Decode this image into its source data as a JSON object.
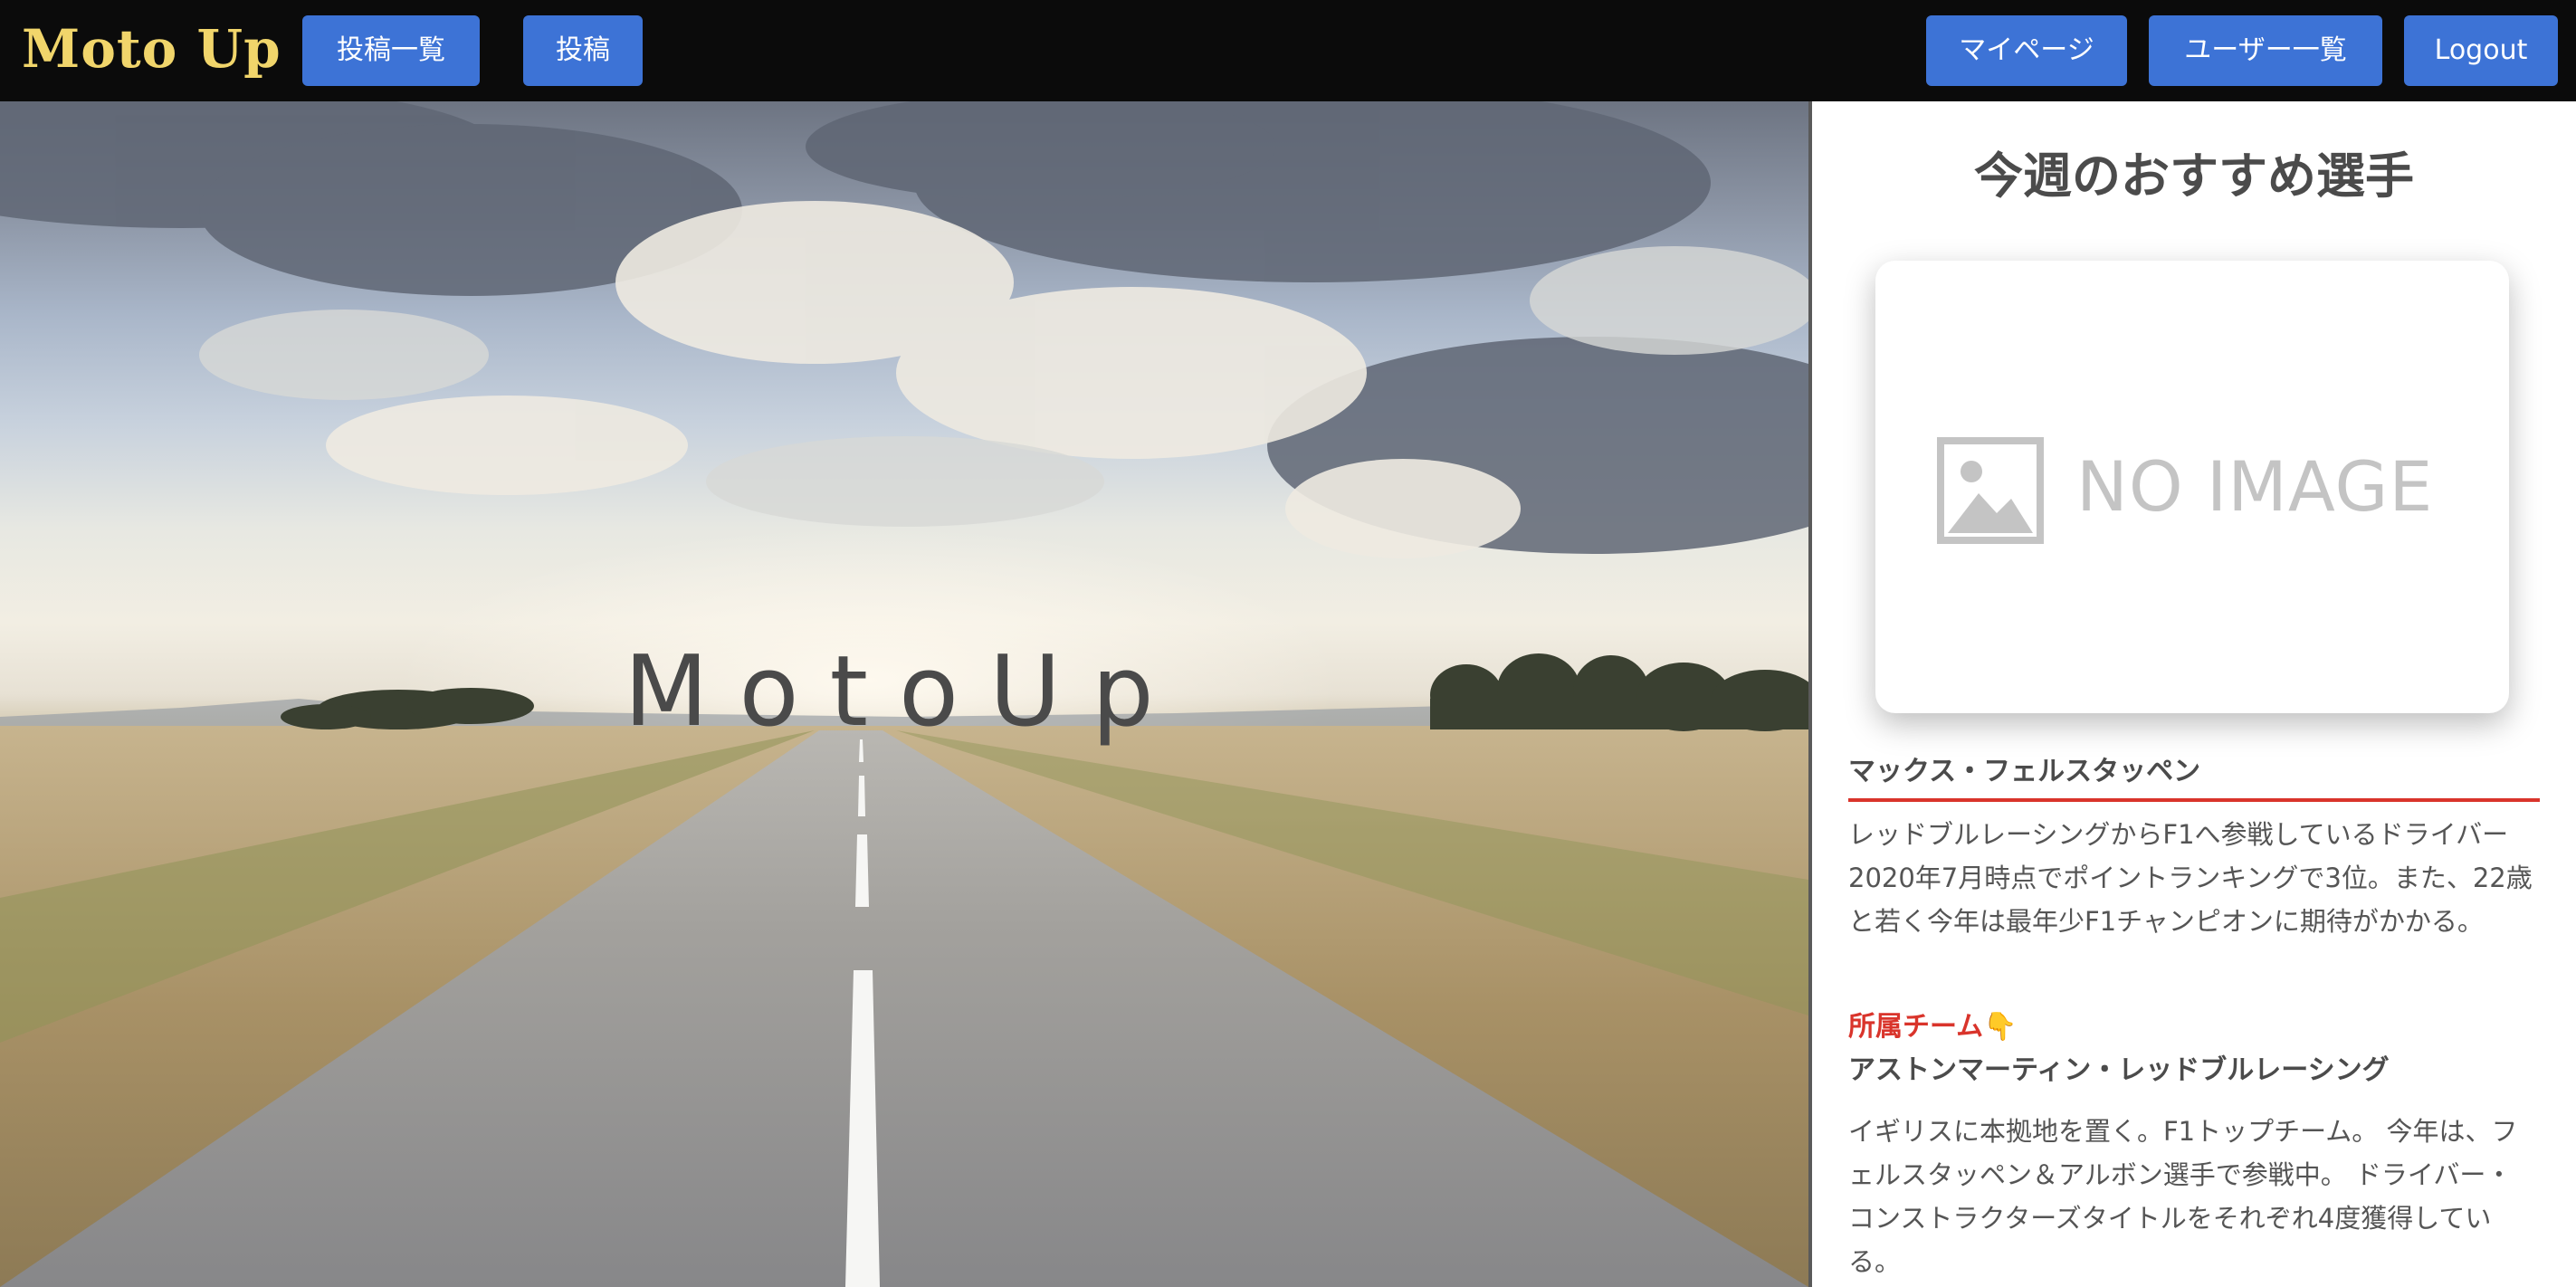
{
  "header": {
    "logo": "Moto Up",
    "nav_left": [
      {
        "label": "投稿一覧"
      },
      {
        "label": "投稿"
      }
    ],
    "nav_right": [
      {
        "label": "マイページ"
      },
      {
        "label": "ユーザー一覧"
      },
      {
        "label": "Logout"
      }
    ]
  },
  "hero": {
    "title": "MotoUp",
    "image": "road-landscape-photo"
  },
  "sidebar": {
    "heading": "今週のおすすめ選手",
    "placeholder_text": "NO IMAGE",
    "player_name": "マックス・フェルスタッペン",
    "player_description": "レッドブルレーシングからF1へ参戦しているドライバー 2020年7月時点でポイントランキングで3位。また、22歳と若く今年は最年少F1チャンピオンに期待がかかる。",
    "team_label": "所属チーム👇",
    "team_name": "アストンマーティン・レッドブルレーシング",
    "team_description": "イギリスに本拠地を置く。F1トップチーム。 今年は、フェルスタッペン＆アルボン選手で参戦中。 ドライバー・コンストラクターズタイトルをそれぞれ4度獲得している。"
  },
  "colors": {
    "header_bg": "#0b0b0b",
    "logo": "#f1d56b",
    "nav_button": "#3d73d6",
    "accent_red": "#d9342b",
    "text_dark": "#4b4b4b"
  }
}
